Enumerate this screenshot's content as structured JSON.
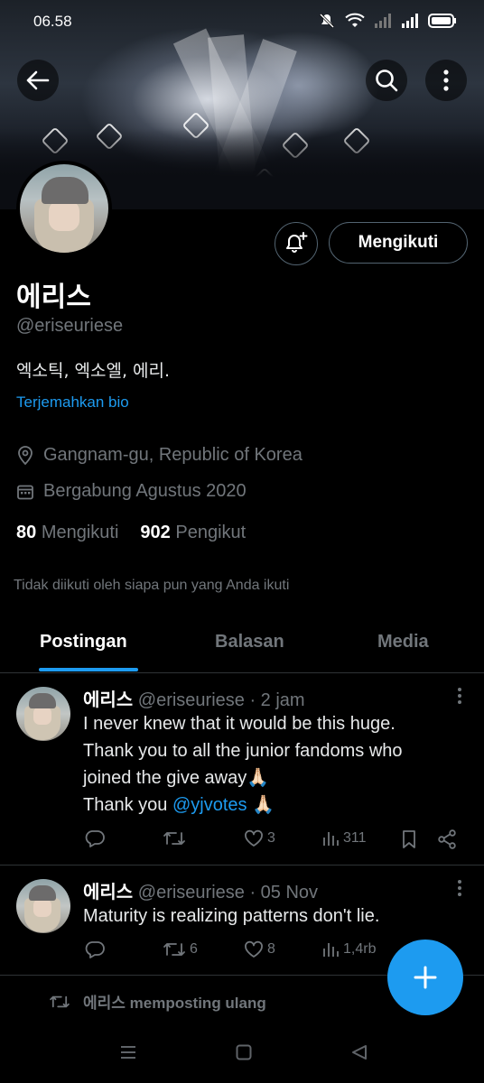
{
  "status_bar": {
    "time": "06.58"
  },
  "profile": {
    "name": "에리스",
    "handle": "@eriseuriese",
    "bio": "엑소틱, 엑소엘, 에리.",
    "translate_bio": "Terjemahkan bio",
    "location": "Gangnam-gu, Republic of Korea",
    "joined": "Bergabung Agustus 2020",
    "following_count": "80",
    "following_label": "Mengikuti",
    "followers_count": "902",
    "followers_label": "Pengikut",
    "not_followed_note": "Tidak diikuti oleh siapa pun yang Anda ikuti",
    "follow_button": "Mengikuti"
  },
  "tabs": [
    {
      "label": "Postingan",
      "active": true
    },
    {
      "label": "Balasan",
      "active": false
    },
    {
      "label": "Media",
      "active": false
    }
  ],
  "posts": [
    {
      "name": "에리스",
      "handle": "@eriseuriese",
      "time": "· 2 jam",
      "lines": [
        "I never knew that it would be this huge.",
        "Thank you to all the junior fandoms who",
        "joined the give away🙏🏻"
      ],
      "last_line_prefix": "Thank you ",
      "mention": "@yjvotes",
      "last_line_suffix": " 🙏🏻",
      "replies": "",
      "reposts": "",
      "likes": "3",
      "views": "311"
    },
    {
      "name": "에리스",
      "handle": "@eriseuriese",
      "time": "· 05 Nov",
      "text": "Maturity is realizing patterns don't lie.",
      "replies": "",
      "reposts": "6",
      "likes": "8",
      "views": "1,4rb"
    }
  ],
  "repost_notice": "에리스 memposting ulang",
  "colors": {
    "accent": "#1d9bf0",
    "muted": "#71767b",
    "background": "#000000"
  },
  "icons": [
    "back-arrow-icon",
    "search-icon",
    "more-vertical-icon",
    "bell-plus-icon",
    "location-pin-icon",
    "calendar-icon",
    "reply-icon",
    "repost-icon",
    "like-icon",
    "views-icon",
    "bookmark-icon",
    "share-icon",
    "compose-plus-icon"
  ]
}
